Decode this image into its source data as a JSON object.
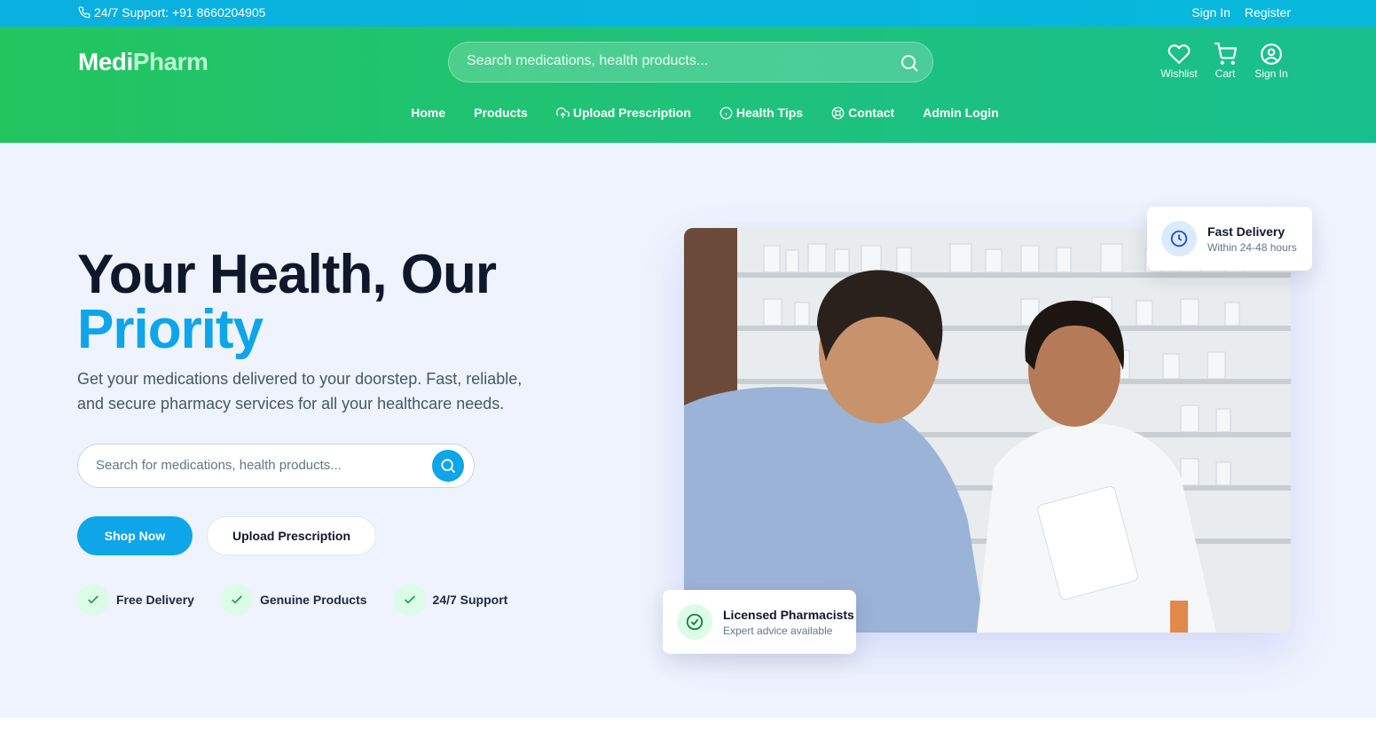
{
  "topbar": {
    "support": "24/7 Support: +91 8660204905",
    "sign_in": "Sign In",
    "register": "Register"
  },
  "header": {
    "logo_part1": "Medi",
    "logo_part2": "Pharm",
    "search_placeholder": "Search medications, health products...",
    "icons": [
      {
        "label": "Wishlist",
        "icon": "heart-icon"
      },
      {
        "label": "Cart",
        "icon": "cart-icon"
      },
      {
        "label": "Sign In",
        "icon": "user-circle-icon"
      }
    ],
    "nav": [
      {
        "label": "Home"
      },
      {
        "label": "Products"
      },
      {
        "label": "Upload Prescription",
        "icon": "upload-cloud-icon"
      },
      {
        "label": "Health Tips",
        "icon": "info-icon"
      },
      {
        "label": "Contact",
        "icon": "lifebuoy-icon"
      },
      {
        "label": "Admin Login"
      }
    ]
  },
  "hero": {
    "title_line1": "Your Health, Our",
    "title_line2": "Priority",
    "description": "Get your medications delivered to your doorstep. Fast, reliable, and secure pharmacy services for all your healthcare needs.",
    "search_placeholder": "Search for medications, health products...",
    "shop_now": "Shop Now",
    "upload_prescription": "Upload Prescription",
    "features": [
      "Free Delivery",
      "Genuine Products",
      "24/7 Support"
    ],
    "card_fast": {
      "title": "Fast Delivery",
      "subtitle": "Within 24-48 hours"
    },
    "card_licensed": {
      "title": "Licensed Pharmacists",
      "subtitle": "Expert advice available"
    }
  },
  "colors": {
    "topbar": "#0ab0df",
    "header_start": "#22c55e",
    "header_end": "#18bf8d",
    "accent": "#0ea5e9",
    "hero_bg": "#eef3fd"
  }
}
